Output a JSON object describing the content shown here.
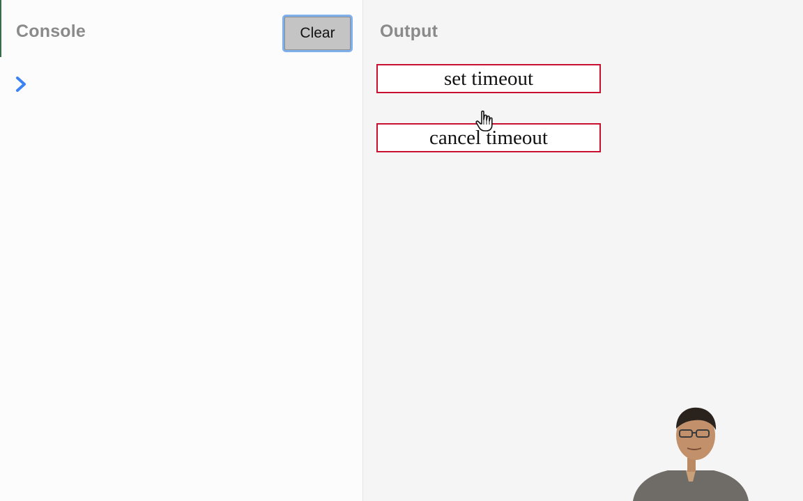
{
  "console": {
    "title": "Console",
    "clear_label": "Clear"
  },
  "output": {
    "title": "Output",
    "buttons": [
      {
        "label": "set timeout"
      },
      {
        "label": "cancel timeout"
      }
    ]
  },
  "icons": {
    "prompt": "chevron-right-icon",
    "cursor": "hand-pointer-icon"
  },
  "colors": {
    "prompt_accent": "#3b82f6",
    "button_border": "#c8102e",
    "clear_focus_ring": "#7fb0ee",
    "title_gray": "#8a8a8a"
  }
}
